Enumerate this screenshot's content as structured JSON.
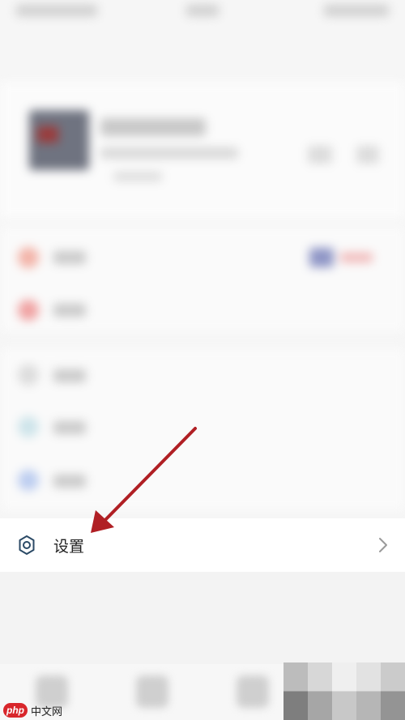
{
  "settings": {
    "label": "设置",
    "icon": "gear-icon",
    "chevron_icon": "chevron-right-icon"
  },
  "watermark": {
    "logo": "php",
    "text": "中文网"
  },
  "colors": {
    "arrow": "#b01f24",
    "icon_stroke": "#2b4a66"
  }
}
